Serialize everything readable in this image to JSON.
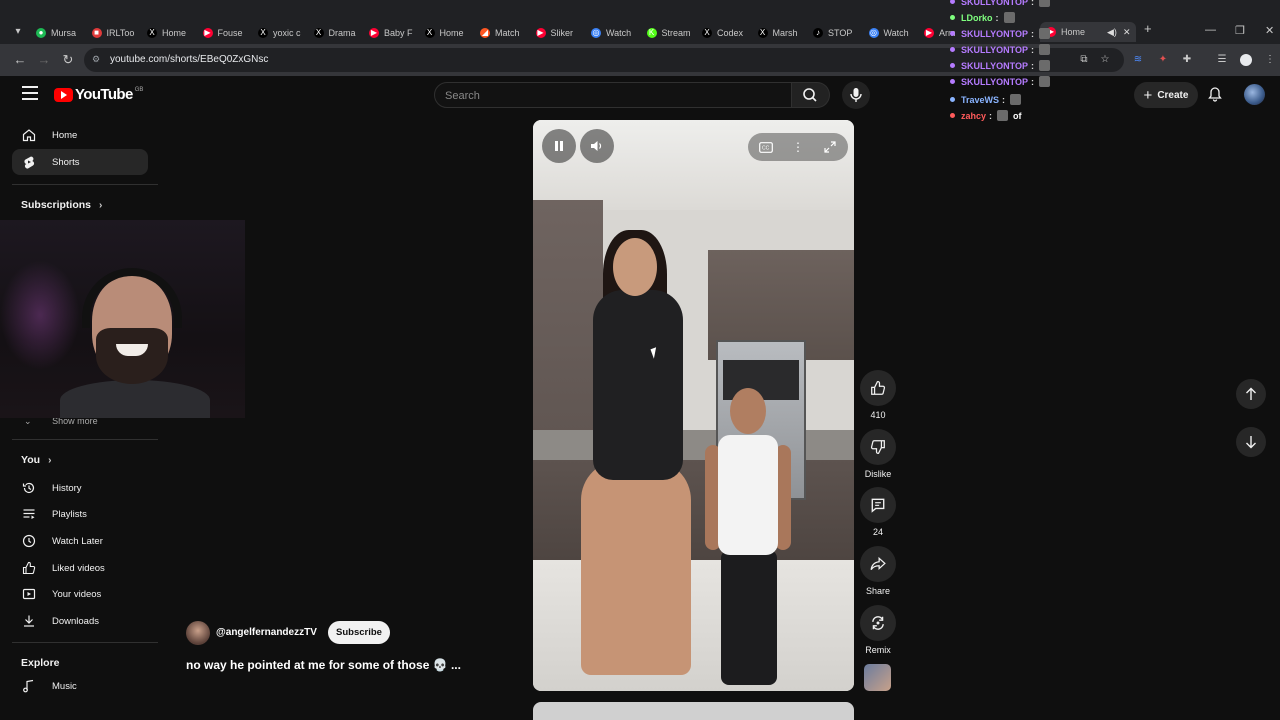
{
  "browser": {
    "tabs": [
      {
        "label": "Mursa",
        "color": "#1db954",
        "glyph": "●"
      },
      {
        "label": "IRLToo",
        "color": "#e03a3a",
        "glyph": "■"
      },
      {
        "label": "Home",
        "color": "#000000",
        "glyph": "X"
      },
      {
        "label": "Fouse",
        "color": "#ff0033",
        "glyph": "▶"
      },
      {
        "label": "yoxic c",
        "color": "#000000",
        "glyph": "X"
      },
      {
        "label": "Drama",
        "color": "#000000",
        "glyph": "X"
      },
      {
        "label": "Baby F",
        "color": "#ff0033",
        "glyph": "▶"
      },
      {
        "label": "Home",
        "color": "#000000",
        "glyph": "X"
      },
      {
        "label": "Match",
        "color": "#ff5722",
        "glyph": "◢"
      },
      {
        "label": "Sliker",
        "color": "#ff0033",
        "glyph": "▶"
      },
      {
        "label": "Watch",
        "color": "#3b82f6",
        "glyph": "◎"
      },
      {
        "label": "Stream",
        "color": "#53fc18",
        "glyph": "K"
      },
      {
        "label": "Codex",
        "color": "#000000",
        "glyph": "X"
      },
      {
        "label": "Marsh",
        "color": "#000000",
        "glyph": "X"
      },
      {
        "label": "STOP",
        "color": "#000000",
        "glyph": "♪"
      },
      {
        "label": "Watch",
        "color": "#3b82f6",
        "glyph": "◎"
      },
      {
        "label": "Arm",
        "color": "#ff0033",
        "glyph": "▶"
      }
    ],
    "active_tab": {
      "label": "Home"
    },
    "url": "youtube.com/shorts/EBeQ0ZxGNsc",
    "new_tab": "+"
  },
  "youtube": {
    "logo_text": "YouTube",
    "country_code": "GB",
    "search_placeholder": "Search",
    "create_label": "Create"
  },
  "sidebar": {
    "top_items": [
      {
        "label": "Home",
        "icon": "home-icon"
      },
      {
        "label": "Shorts",
        "icon": "shorts-icon",
        "active": true
      }
    ],
    "subscriptions_label": "Subscriptions",
    "show_more": "Show more",
    "you_label": "You",
    "you_items": [
      {
        "label": "History",
        "icon": "history-icon"
      },
      {
        "label": "Playlists",
        "icon": "playlists-icon"
      },
      {
        "label": "Watch Later",
        "icon": "clock-icon"
      },
      {
        "label": "Liked videos",
        "icon": "thumbs-up-icon"
      },
      {
        "label": "Your videos",
        "icon": "play-icon"
      },
      {
        "label": "Downloads",
        "icon": "download-icon"
      }
    ],
    "explore_label": "Explore",
    "explore_items": [
      {
        "label": "Music",
        "icon": "music-icon"
      }
    ]
  },
  "short": {
    "channel": "@angelfernandezzTV",
    "subscribe_label": "Subscribe",
    "caption": "no way he pointed at me for some of those 💀 ...",
    "likes": "410",
    "dislike_label": "Dislike",
    "comments": "24",
    "share_label": "Share",
    "remix_label": "Remix"
  },
  "chat": [
    {
      "user": "SKULLYONTOP",
      "color": "#b57bff"
    },
    {
      "user": "LDorko",
      "color": "#7fff7f"
    },
    {
      "user": "SKULLYONTOP",
      "color": "#b57bff"
    },
    {
      "user": "SKULLYONTOP",
      "color": "#b57bff"
    },
    {
      "user": "SKULLYONTOP",
      "color": "#b57bff"
    },
    {
      "user": "SKULLYONTOP",
      "color": "#b57bff"
    },
    {
      "user": "TraveWS",
      "color": "#8ab4ff"
    },
    {
      "user": "zahcy",
      "color": "#ff5b5b",
      "message": "of"
    }
  ],
  "colors": {
    "background": "#0f0f0f",
    "youtube_red": "#ff0000",
    "sidebar_active": "#272727"
  }
}
